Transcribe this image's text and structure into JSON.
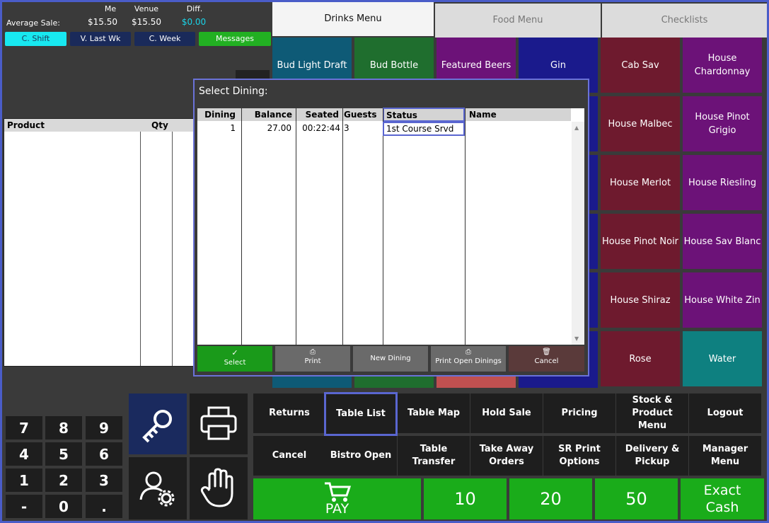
{
  "stats": {
    "average_sale_label": "Average Sale:",
    "col_me": "Me",
    "col_venue": "Venue",
    "col_diff": "Diff.",
    "me_value": "$15.50",
    "venue_value": "$15.50",
    "diff_value": "$0.00",
    "buttons": [
      "C. Shift",
      "V. Last Wk",
      "C. Week",
      "Messages"
    ]
  },
  "order": {
    "col_product": "Product",
    "col_qty": "Qty"
  },
  "tabs": [
    "Drinks Menu",
    "Food Menu",
    "Checklists"
  ],
  "tiles": [
    "Bud Light Draft",
    "Bud Bottle",
    "Featured Beers",
    "Gin",
    "Cab Sav",
    "House Chardonnay",
    "House Malbec",
    "House Pinot Grigio",
    "House Merlot",
    "House Riesling",
    "House Pinot Noir",
    "House Sav Blanc",
    "House Shiraz",
    "House White Zin",
    "Rose",
    "Water"
  ],
  "dialog": {
    "title": "Select Dining:",
    "columns": [
      "Dining",
      "Balance",
      "Seated",
      "Guests",
      "Status",
      "Name"
    ],
    "rows": [
      {
        "dining": "1",
        "balance": "27.00",
        "seated": "00:22:44",
        "guests": "3",
        "status": "1st Course Srvd",
        "name": ""
      }
    ],
    "buttons": [
      "Select",
      "Print",
      "New Dining",
      "Print Open Dinings",
      "Cancel"
    ]
  },
  "functions": [
    "Returns",
    "Table List",
    "Table Map",
    "Hold Sale",
    "Pricing",
    "Stock & Product Menu",
    "Logout",
    "Cancel",
    "Bistro Open",
    "Table Transfer",
    "Take Away Orders",
    "SR Print Options",
    "Delivery & Pickup",
    "Manager Menu"
  ],
  "numpad": [
    "7",
    "8",
    "9",
    "4",
    "5",
    "6",
    "1",
    "2",
    "3",
    "-",
    "0",
    "."
  ],
  "pay": {
    "label": "PAY",
    "cash_10": "10",
    "cash_20": "20",
    "cash_50": "50",
    "exact_cash": "Exact Cash"
  },
  "colors": {
    "accent": "#5a66d0",
    "green": "#1aac1a",
    "maroon": "#6e1a2e",
    "purple": "#6c1278",
    "navy": "#1a1a8c",
    "teal": "#0e8080"
  }
}
